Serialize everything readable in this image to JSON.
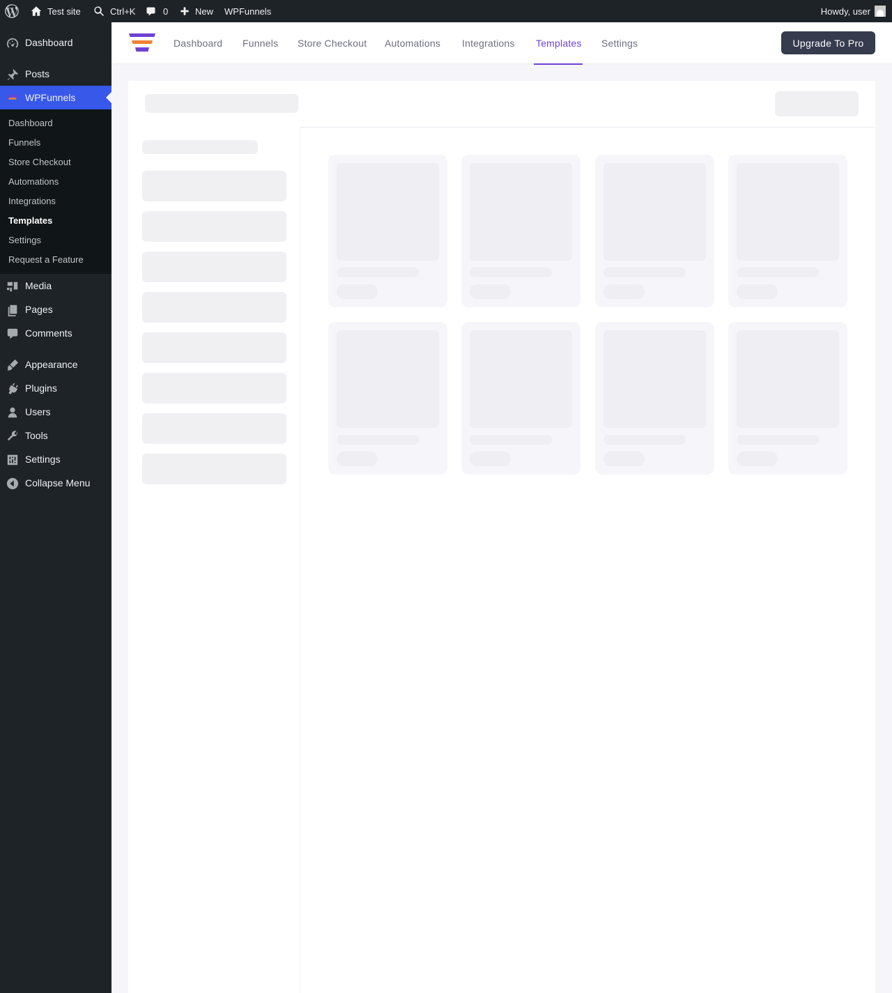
{
  "adminbar": {
    "site_name": "Test site",
    "search_shortcut": "Ctrl+K",
    "comments_count": "0",
    "new_label": "New",
    "plugin_label": "WPFunnels",
    "howdy": "Howdy, user"
  },
  "sidebar": {
    "items": [
      {
        "label": "Dashboard",
        "icon": "dashboard-icon"
      },
      {
        "label": "Posts",
        "icon": "pushpin-icon"
      },
      {
        "label": "WPFunnels",
        "icon": "wpfunnels-icon"
      },
      {
        "label": "Media",
        "icon": "media-icon"
      },
      {
        "label": "Pages",
        "icon": "pages-icon"
      },
      {
        "label": "Comments",
        "icon": "comment-icon"
      },
      {
        "label": "Appearance",
        "icon": "brush-icon"
      },
      {
        "label": "Plugins",
        "icon": "plug-icon"
      },
      {
        "label": "Users",
        "icon": "user-icon"
      },
      {
        "label": "Tools",
        "icon": "wrench-icon"
      },
      {
        "label": "Settings",
        "icon": "settings-icon"
      },
      {
        "label": "Collapse Menu",
        "icon": "collapse-icon"
      }
    ],
    "submenu": [
      "Dashboard",
      "Funnels",
      "Store Checkout",
      "Automations",
      "Integrations",
      "Templates",
      "Settings",
      "Request a Feature"
    ],
    "current_item": "WPFunnels",
    "current_submenu": "Templates"
  },
  "topnav": {
    "links": [
      "Dashboard",
      "Funnels",
      "Store Checkout",
      "Automations",
      "Integrations",
      "Templates",
      "Settings"
    ],
    "active": "Templates",
    "upgrade_label": "Upgrade To Pro"
  },
  "colors": {
    "accent": "#6e42d3",
    "admin_bar": "#1d2327",
    "sidebar_current": "#3858e9",
    "upgrade_button": "#363b4e",
    "logo_purple": "#6e42d3",
    "logo_orange": "#ee8134"
  }
}
